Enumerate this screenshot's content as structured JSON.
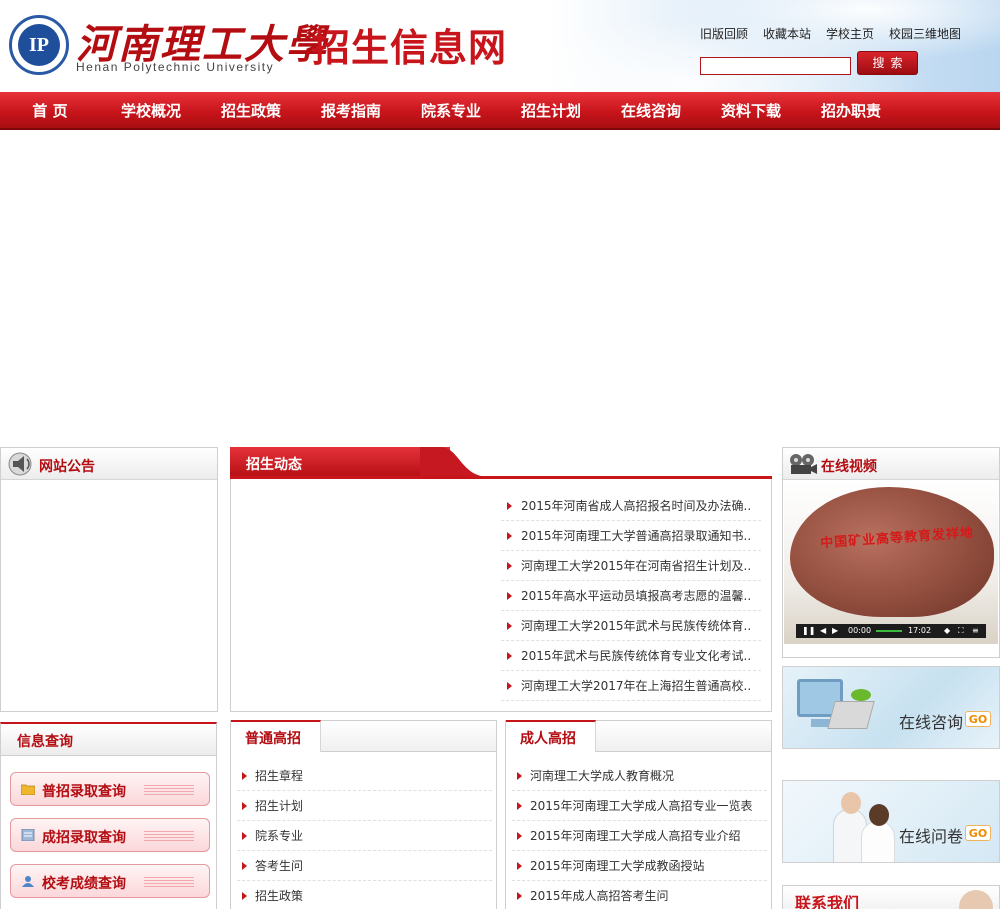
{
  "header": {
    "emblem_text": "IP",
    "university_cn": "河南理工大學",
    "university_en": "Henan Polytechnic University",
    "site_title": "招生信息网",
    "top_links": [
      "旧版回顾",
      "收藏本站",
      "学校主页",
      "校园三维地图"
    ],
    "search_placeholder": "",
    "search_button": "搜索"
  },
  "nav": [
    "首 页",
    "学校概况",
    "招生政策",
    "报考指南",
    "院系专业",
    "招生计划",
    "在线咨询",
    "资料下载",
    "招办职责"
  ],
  "notice": {
    "title": "网站公告",
    "icon": "speaker-icon"
  },
  "news": {
    "title": "招生动态",
    "items": [
      "2015年河南省成人高招报名时间及办法确..",
      "2015年河南理工大学普通高招录取通知书..",
      "河南理工大学2015年在河南省招生计划及..",
      "2015年高水平运动员填报高考志愿的温馨..",
      "河南理工大学2015年武术与民族传统体育..",
      "2015年武术与民族传统体育专业文化考试..",
      "河南理工大学2017年在上海招生普通高校.."
    ]
  },
  "video": {
    "title": "在线视频",
    "icon": "film-icon",
    "rock_inscription": "中国矿业高等教育发祥地",
    "time_current": "00:00",
    "time_total": "17:02"
  },
  "ads": {
    "consult": {
      "label": "在线咨询",
      "go": "GO"
    },
    "survey": {
      "label": "在线问卷",
      "go": "GO"
    },
    "contact": {
      "label": "联系我们"
    }
  },
  "info_query": {
    "title": "信息查询",
    "buttons": [
      "普招录取查询",
      "成招录取查询",
      "校考成绩查询"
    ]
  },
  "general": {
    "title": "普通高招",
    "items": [
      "招生章程",
      "招生计划",
      "院系专业",
      "答考生问",
      "招生政策"
    ]
  },
  "adult": {
    "title": "成人高招",
    "items": [
      "河南理工大学成人教育概况",
      "2015年河南理工大学成人高招专业一览表",
      "2015年河南理工大学成人高招专业介绍",
      "2015年河南理工大学成教函授站",
      "2015年成人高招答考生问"
    ]
  },
  "colors": {
    "brand_red": "#c8151b",
    "dark_red": "#b30d12"
  }
}
